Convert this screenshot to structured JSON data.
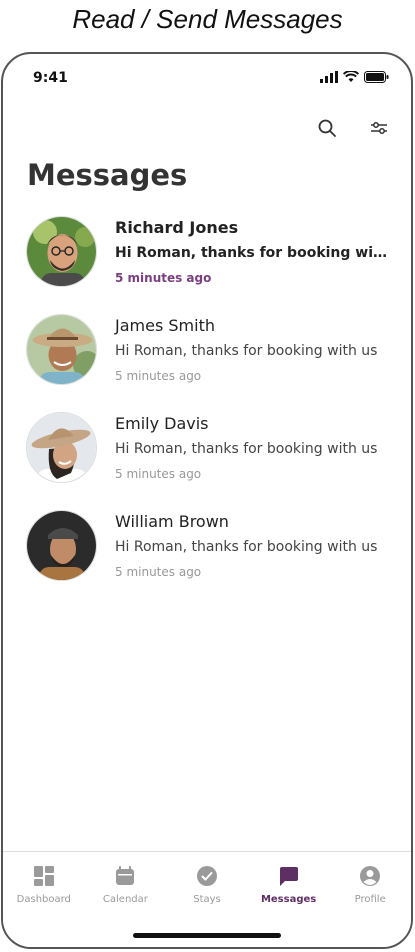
{
  "caption": "Read / Send Messages",
  "status_bar": {
    "time": "9:41"
  },
  "header": {
    "title": "Messages",
    "search_icon": "search-icon",
    "filter_icon": "sliders-icon"
  },
  "conversations": [
    {
      "name": "Richard Jones",
      "preview": "Hi Roman, thanks for booking with us",
      "time": "5 minutes ago",
      "unread": true
    },
    {
      "name": "James Smith",
      "preview": "Hi Roman, thanks for booking with us",
      "time": "5 minutes ago",
      "unread": false
    },
    {
      "name": "Emily Davis",
      "preview": "Hi Roman, thanks for booking with us",
      "time": "5 minutes ago",
      "unread": false
    },
    {
      "name": "William Brown",
      "preview": "Hi Roman, thanks for booking with us",
      "time": "5 minutes ago",
      "unread": false
    }
  ],
  "tabbar": {
    "items": [
      {
        "label": "Dashboard",
        "icon": "dashboard-icon"
      },
      {
        "label": "Calendar",
        "icon": "calendar-icon"
      },
      {
        "label": "Stays",
        "icon": "stays-icon"
      },
      {
        "label": "Messages",
        "icon": "messages-icon",
        "active": true
      },
      {
        "label": "Profile",
        "icon": "profile-icon"
      }
    ]
  },
  "colors": {
    "accent": "#5e2f63",
    "unread_time": "#7a3f80",
    "inactive_icon": "#9a9a9a"
  }
}
